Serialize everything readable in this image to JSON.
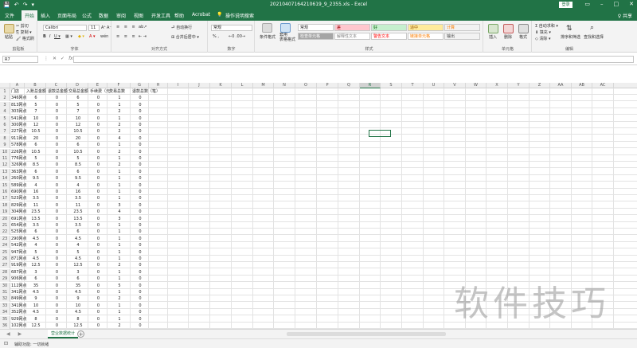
{
  "window": {
    "quick_access": [
      "💾",
      "↶",
      "↷",
      "▾"
    ],
    "title": "20210407164210619_9_2355.xls  -  Excel",
    "login": "登录",
    "controls": [
      "▭",
      "–",
      "□",
      "✕"
    ]
  },
  "tabs": [
    "文件",
    "开始",
    "插入",
    "页面布局",
    "公式",
    "数据",
    "审阅",
    "视图",
    "开发工具",
    "帮助",
    "Acrobat",
    "💡",
    "操作说明搜索"
  ],
  "share": "♀ 共享",
  "ribbon": {
    "clipboard": {
      "label": "剪贴板",
      "paste": "粘贴",
      "cut": "✂ 剪切",
      "copy": "⎘ 复制 ▾",
      "format_painter": "🖌 格式刷"
    },
    "font": {
      "label": "字体",
      "font_name": "Calibri",
      "font_size": "11",
      "grow": "A⁺",
      "shrink": "A⁻",
      "bold": "B",
      "italic": "I",
      "underline": "U ▾",
      "border": "▦ ▾",
      "fill": "◆ ▾",
      "color": "A ▾",
      "wen": "wén"
    },
    "alignment": {
      "label": "对齐方式",
      "wrap": "⮐ 自动换行",
      "merge": "⊞ 合并后居中 ▾"
    },
    "number": {
      "label": "数字",
      "format": "常规",
      "percent": "% ,",
      "decimals": "←0 .00→"
    },
    "styles": {
      "label": "样式",
      "conditional": "条件格式",
      "table": "套用\n表格格式",
      "cells": [
        {
          "text": "常规",
          "bg": "#ffffff",
          "color": "#222222"
        },
        {
          "text": "差",
          "bg": "#ffc7ce",
          "color": "#9c0006"
        },
        {
          "text": "好",
          "bg": "#c6efce",
          "color": "#006100"
        },
        {
          "text": "适中",
          "bg": "#ffeb9c",
          "color": "#9c5700"
        },
        {
          "text": "计算",
          "bg": "#f2f2f2",
          "color": "#fa7d00"
        },
        {
          "text": "检查单元格",
          "bg": "#a5a5a5",
          "color": "#ffffff"
        },
        {
          "text": "解释性文本",
          "bg": "#ffffff",
          "color": "#7f7f7f"
        },
        {
          "text": "警告文本",
          "bg": "#ffffff",
          "color": "#ff0000"
        },
        {
          "text": "链接单元格",
          "bg": "#ffffff",
          "color": "#fa7d00"
        },
        {
          "text": "输出",
          "bg": "#f2f2f2",
          "color": "#3f3f3f"
        }
      ]
    },
    "cells_group": {
      "label": "单元格",
      "insert": "插入",
      "delete": "删除",
      "format": "格式"
    },
    "editing": {
      "label": "编辑",
      "autosum": "Σ 自动求和 ▾",
      "fill": "⬇ 填充 ▾",
      "clear": "◇ 清除 ▾",
      "sort": "排序和筛选",
      "find": "查找和选择"
    }
  },
  "formula_bar": {
    "name_box": "R7",
    "icons": [
      "⋮",
      "✕",
      "✓",
      "fx"
    ],
    "value": ""
  },
  "columns": [
    "A",
    "B",
    "C",
    "D",
    "E",
    "F",
    "G",
    "H",
    "I",
    "J",
    "K",
    "L",
    "M",
    "N",
    "O",
    "P",
    "Q",
    "R",
    "S",
    "T",
    "U",
    "V",
    "W",
    "X",
    "Y",
    "Z",
    "AA",
    "AB",
    "AC"
  ],
  "selected_column": "R",
  "rows": [
    [
      "1",
      "门店",
      "入账总金额",
      "退款总金额",
      "交易总金额",
      "手续费（元）",
      "交易总数",
      "退款总数（笔）",
      ""
    ],
    [
      "2",
      "346网点",
      "6",
      "0",
      "6",
      "0",
      "1",
      "0"
    ],
    [
      "3",
      "813网点",
      "5",
      "0",
      "5",
      "0",
      "1",
      "0"
    ],
    [
      "4",
      "303网点",
      "7",
      "0",
      "7",
      "0",
      "2",
      "0"
    ],
    [
      "5",
      "541网点",
      "10",
      "0",
      "10",
      "0",
      "1",
      "0"
    ],
    [
      "6",
      "300网点",
      "12",
      "0",
      "12",
      "0",
      "2",
      "0"
    ],
    [
      "7",
      "227网点",
      "10.5",
      "0",
      "10.5",
      "0",
      "2",
      "0"
    ],
    [
      "8",
      "911网点",
      "20",
      "0",
      "20",
      "0",
      "4",
      "0"
    ],
    [
      "9",
      "578网点",
      "6",
      "0",
      "6",
      "0",
      "1",
      "0"
    ],
    [
      "10",
      "226网点",
      "10.5",
      "0",
      "10.5",
      "0",
      "2",
      "0"
    ],
    [
      "11",
      "776网点",
      "5",
      "0",
      "5",
      "0",
      "1",
      "0"
    ],
    [
      "12",
      "326网点",
      "8.5",
      "0",
      "8.5",
      "0",
      "2",
      "0"
    ],
    [
      "13",
      "363网点",
      "6",
      "0",
      "6",
      "0",
      "1",
      "0"
    ],
    [
      "14",
      "260网点",
      "9.5",
      "0",
      "9.5",
      "0",
      "1",
      "0"
    ],
    [
      "15",
      "589网点",
      "4",
      "0",
      "4",
      "0",
      "1",
      "0"
    ],
    [
      "16",
      "690网点",
      "16",
      "0",
      "16",
      "0",
      "1",
      "0"
    ],
    [
      "17",
      "523网点",
      "3.5",
      "0",
      "3.5",
      "0",
      "1",
      "0"
    ],
    [
      "18",
      "829网点",
      "11",
      "0",
      "11",
      "0",
      "3",
      "0"
    ],
    [
      "19",
      "304网点",
      "23.5",
      "0",
      "23.5",
      "0",
      "4",
      "0"
    ],
    [
      "20",
      "691网点",
      "13.5",
      "0",
      "13.5",
      "0",
      "3",
      "0"
    ],
    [
      "21",
      "654网点",
      "3.5",
      "0",
      "3.5",
      "0",
      "1",
      "0"
    ],
    [
      "22",
      "525网点",
      "6",
      "0",
      "6",
      "0",
      "1",
      "0"
    ],
    [
      "23",
      "290网点",
      "4.5",
      "0",
      "4.5",
      "0",
      "1",
      "0"
    ],
    [
      "24",
      "542网点",
      "4",
      "0",
      "4",
      "0",
      "1",
      "0"
    ],
    [
      "25",
      "947网点",
      "5",
      "0",
      "5",
      "0",
      "1",
      "0"
    ],
    [
      "26",
      "871网点",
      "4.5",
      "0",
      "4.5",
      "0",
      "1",
      "0"
    ],
    [
      "27",
      "919网点",
      "12.5",
      "0",
      "12.5",
      "0",
      "2",
      "0"
    ],
    [
      "28",
      "687网点",
      "3",
      "0",
      "3",
      "0",
      "1",
      "0"
    ],
    [
      "29",
      "906网点",
      "6",
      "0",
      "6",
      "0",
      "1",
      "0"
    ],
    [
      "30",
      "112网点",
      "35",
      "0",
      "35",
      "0",
      "5",
      "0"
    ],
    [
      "31",
      "341网点",
      "4.5",
      "0",
      "4.5",
      "0",
      "1",
      "0"
    ],
    [
      "32",
      "849网点",
      "9",
      "0",
      "9",
      "0",
      "2",
      "0"
    ],
    [
      "33",
      "341网点",
      "10",
      "0",
      "10",
      "0",
      "1",
      "0"
    ],
    [
      "34",
      "352网点",
      "4.5",
      "0",
      "4.5",
      "0",
      "1",
      "0"
    ],
    [
      "35",
      "929网点",
      "8",
      "0",
      "8",
      "0",
      "1",
      "0"
    ],
    [
      "36",
      "102网点",
      "12.5",
      "0",
      "12.5",
      "0",
      "2",
      "0"
    ]
  ],
  "sheet_nav": [
    "◀",
    "▶"
  ],
  "sheet_tab": "营业数据统计",
  "add_sheet": "+",
  "status": {
    "accessibility": "⊡",
    "text": "辅助功能: 一切就绪"
  },
  "watermark": "软件技巧"
}
